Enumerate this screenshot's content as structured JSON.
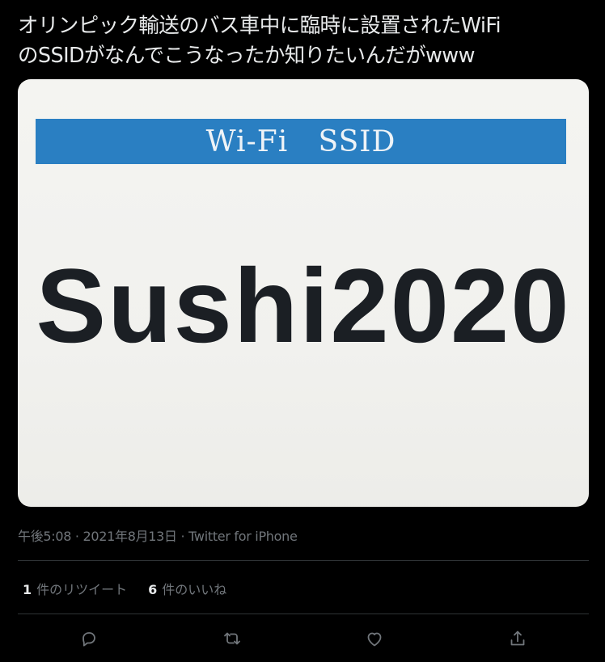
{
  "tweet": {
    "text": "オリンピック輸送のバス車中に臨時に設置されたWiFi\nのSSIDがなんでこうなったか知りたいんだがwww",
    "timestamp": "午後5:08 · 2021年8月13日 · Twitter for iPhone"
  },
  "image": {
    "banner_label": "Wi-Fi   SSID",
    "ssid_text": "Sushi2020",
    "banner_color": "#2a7fc2"
  },
  "stats": {
    "retweets_count": "1",
    "retweets_label": "件のリツイート",
    "likes_count": "6",
    "likes_label": "件のいいね"
  },
  "actions": {
    "reply_icon": "reply-icon",
    "retweet_icon": "retweet-icon",
    "like_icon": "like-icon",
    "share_icon": "share-icon"
  },
  "colors": {
    "background": "#000000",
    "text": "#e7e9ea",
    "secondary": "#71767b",
    "divider": "#2f3336"
  }
}
